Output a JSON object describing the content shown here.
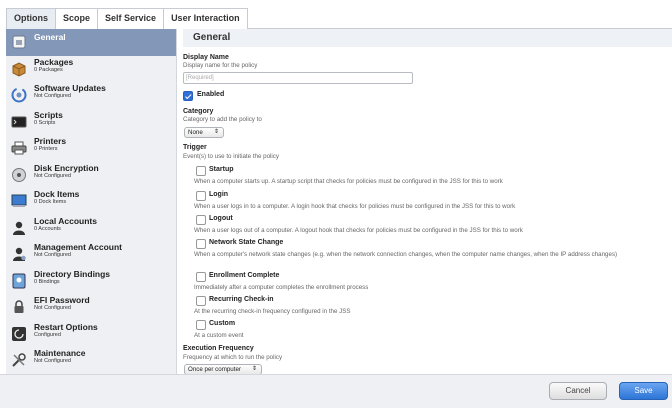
{
  "tabs": [
    "Options",
    "Scope",
    "Self Service",
    "User Interaction"
  ],
  "sidebar": {
    "items": [
      {
        "label": "General",
        "sub": "",
        "icon": "general-icon"
      },
      {
        "label": "Packages",
        "sub": "0 Packages",
        "icon": "package-icon"
      },
      {
        "label": "Software Updates",
        "sub": "Not Configured",
        "icon": "software-update-icon"
      },
      {
        "label": "Scripts",
        "sub": "0 Scripts",
        "icon": "script-icon"
      },
      {
        "label": "Printers",
        "sub": "0 Printers",
        "icon": "printer-icon"
      },
      {
        "label": "Disk Encryption",
        "sub": "Not Configured",
        "icon": "disk-icon"
      },
      {
        "label": "Dock Items",
        "sub": "0 Dock Items",
        "icon": "dock-icon"
      },
      {
        "label": "Local Accounts",
        "sub": "0 Accounts",
        "icon": "user-icon"
      },
      {
        "label": "Management Account",
        "sub": "Not Configured",
        "icon": "admin-user-icon"
      },
      {
        "label": "Directory Bindings",
        "sub": "0 Bindings",
        "icon": "directory-icon"
      },
      {
        "label": "EFI Password",
        "sub": "Not Configured",
        "icon": "lock-icon"
      },
      {
        "label": "Restart Options",
        "sub": "Configured",
        "icon": "restart-icon"
      },
      {
        "label": "Maintenance",
        "sub": "Not Configured",
        "icon": "tools-icon"
      }
    ]
  },
  "main": {
    "title": "General",
    "display_name": {
      "label": "Display Name",
      "desc": "Display name for the policy",
      "placeholder": "[Required]"
    },
    "enabled_label": "Enabled",
    "category": {
      "label": "Category",
      "desc": "Category to add the policy to",
      "value": "None"
    },
    "trigger": {
      "label": "Trigger",
      "desc": "Event(s) to use to initiate the policy",
      "items": [
        {
          "label": "Startup",
          "desc": "When a computer starts up. A startup script that checks for policies must be configured in the JSS for this to work"
        },
        {
          "label": "Login",
          "desc": "When a user logs in to a computer. A login hook that checks for policies must be configured in the JSS for this to work"
        },
        {
          "label": "Logout",
          "desc": "When a user logs out of a computer. A logout hook that checks for policies must be configured in the JSS for this to work"
        },
        {
          "label": "Network State Change",
          "desc": "When a computer's network state changes (e.g. when the network connection changes, when the computer name changes, when the IP address changes)"
        },
        {
          "label": "Enrollment Complete",
          "desc": "Immediately after a computer completes the enrollment process"
        },
        {
          "label": "Recurring Check-in",
          "desc": "At the recurring check-in frequency configured in the JSS"
        },
        {
          "label": "Custom",
          "desc": "At a custom event"
        }
      ]
    },
    "frequency": {
      "label": "Execution Frequency",
      "desc": "Frequency at which to run the policy",
      "value": "Once per computer"
    }
  },
  "footer": {
    "cancel": "Cancel",
    "save": "Save"
  },
  "colors": {
    "accent": "#2d74d6",
    "sidebar_active": "#8397b8"
  }
}
